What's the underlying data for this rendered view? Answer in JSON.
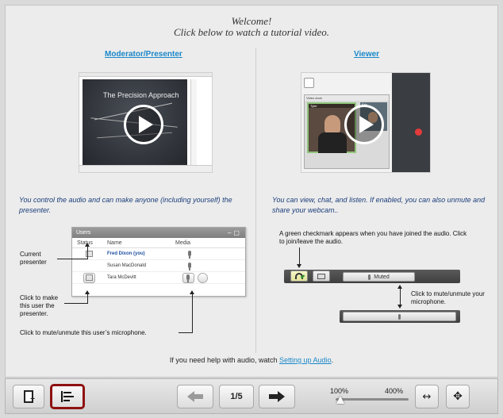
{
  "welcome": {
    "line1": "Welcome!",
    "line2": "Click below to watch a tutorial video."
  },
  "moderator": {
    "title": "Moderator/Presenter",
    "slide_title": "The Precision Approach",
    "description": "You control the audio and can make anyone (including yourself) the presenter."
  },
  "viewer": {
    "title": "Viewer",
    "video_dock_label": "Video dock",
    "tile1_name": "Tyler",
    "tile2_name": "Eric",
    "description": "You can view, chat, and listen.  If enabled, you can also unmute and share your webcam.."
  },
  "users_panel": {
    "title": "Users",
    "columns": [
      "Status",
      "Name",
      "Media"
    ],
    "rows": [
      {
        "name": "Fred Dixon (you)"
      },
      {
        "name": "Susan MacDonald"
      },
      {
        "name": "Tara McDevitt"
      }
    ]
  },
  "notes": {
    "current_presenter": "Current presenter",
    "make_presenter": "Click to make this user the presenter.",
    "mute_user": "Click to mute/unmute this user’s microphone.",
    "checkmark": "A green checkmark appears when you have joined the audio.  Click to join/leave the audio.",
    "mute_mic": "Click to mute/unmute your microphone."
  },
  "audio": {
    "muted_label": "Muted"
  },
  "help": {
    "text": "If you need help with audio, watch",
    "link": "Setting up Audio",
    "end": "."
  },
  "toolbar": {
    "page": "1/5",
    "zoom_min": "100%",
    "zoom_max": "400%",
    "zoom_fraction": 0
  },
  "colors": {
    "link": "#1a88c9",
    "description": "#1a3d7a",
    "active_border": "#8e1111"
  }
}
